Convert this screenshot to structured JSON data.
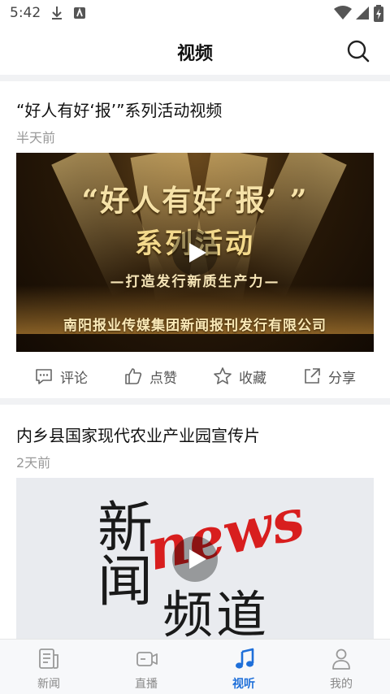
{
  "status_bar": {
    "time": "5:42"
  },
  "header": {
    "title": "视频"
  },
  "feed": [
    {
      "title": "“好人有好‘报’”系列活动视频",
      "time": "半天前",
      "thumb_text": {
        "headline": "“好人有好‘报’  ”",
        "subhead": "系列活动",
        "slogan": "—打造发行新质生产力—",
        "company": "南阳报业传媒集团新闻报刊发行有限公司"
      },
      "actions": [
        {
          "icon": "comment-icon",
          "label": "评论"
        },
        {
          "icon": "thumbs-up-icon",
          "label": "点赞"
        },
        {
          "icon": "star-icon",
          "label": "收藏"
        },
        {
          "icon": "share-icon",
          "label": "分享"
        }
      ]
    },
    {
      "title": "内乡县国家现代农业产业园宣传片",
      "time": "2天前",
      "thumb_text": {
        "left": "新\n闻",
        "news": "news",
        "rest": "频道"
      }
    }
  ],
  "bottom_nav": [
    {
      "icon": "news-icon",
      "label": "新闻",
      "active": false
    },
    {
      "icon": "live-icon",
      "label": "直播",
      "active": false
    },
    {
      "icon": "music-note-icon",
      "label": "视听",
      "active": true
    },
    {
      "icon": "person-icon",
      "label": "我的",
      "active": false
    }
  ],
  "colors": {
    "accent": "#1e6fd9",
    "divider": "#f1f2f4",
    "muted": "#999999"
  }
}
